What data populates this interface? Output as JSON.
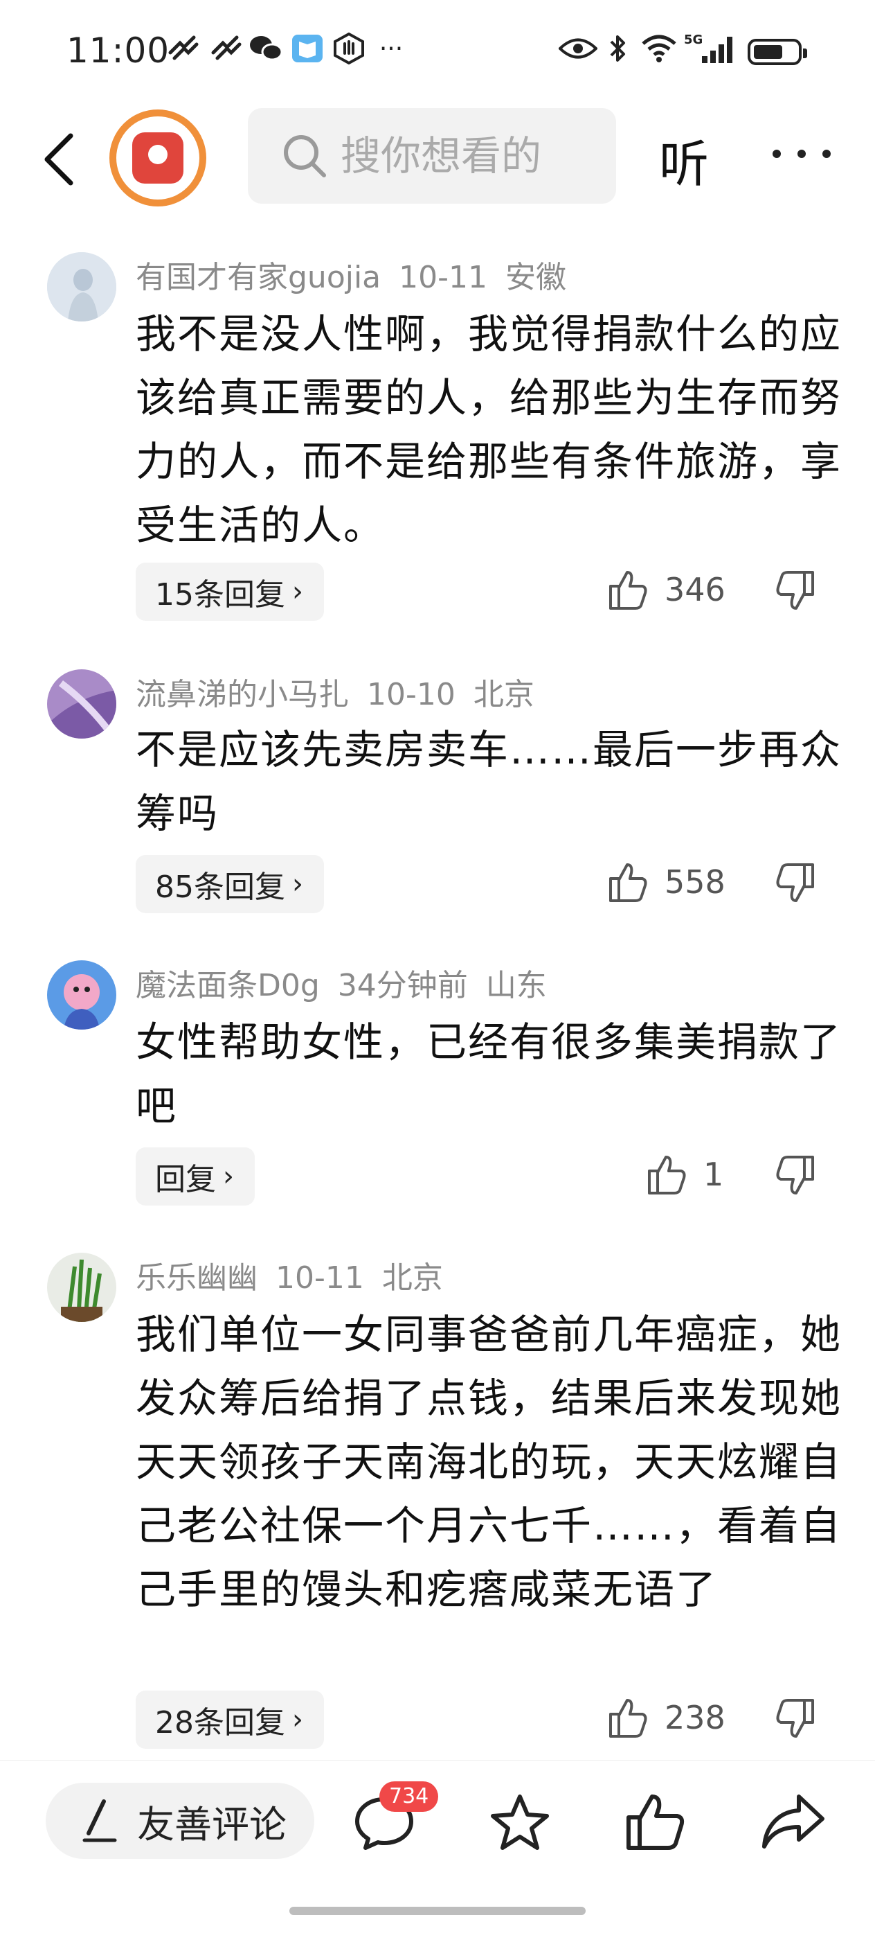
{
  "status_bar": {
    "time": "11:00",
    "network": "5G",
    "colors": {
      "text": "#222222"
    }
  },
  "header": {
    "search_placeholder": "搜你想看的",
    "listen_label": "听",
    "logo_color": "#e0453c",
    "logo_ring_color": "#f0903a"
  },
  "comments": [
    {
      "username": "有国才有家guojia",
      "date": "10-11",
      "location": "安徽",
      "text": "我不是没人性啊，我觉得捐款什么的应该给真正需要的人，给那些为生存而努力的人，而不是给那些有条件旅游，享受生活的人。",
      "reply_label": "15条回复",
      "likes": "346"
    },
    {
      "username": "流鼻涕的小马扎",
      "date": "10-10",
      "location": "北京",
      "text": "不是应该先卖房卖车……最后一步再众筹吗",
      "reply_label": "85条回复",
      "likes": "558"
    },
    {
      "username": "魔法面条D0g",
      "date": "34分钟前",
      "location": "山东",
      "text": "女性帮助女性，已经有很多集美捐款了吧",
      "reply_label": "回复",
      "likes": "1"
    },
    {
      "username": "乐乐幽幽",
      "date": "10-11",
      "location": "北京",
      "text": "我们单位一女同事爸爸前几年癌症，她发众筹后给捐了点钱，结果后来发现她天天领孩子天南海北的玩，天天炫耀自己老公社保一个月六七千……，看着自己手里的馒头和疙瘩咸菜无语了",
      "reply_label": "28条回复",
      "likes": "238"
    }
  ],
  "bottom_bar": {
    "composer_label": "友善评论",
    "comment_count": "734",
    "icons": [
      "pen-icon",
      "comment-icon",
      "star-icon",
      "thumbs-up-icon",
      "share-icon"
    ],
    "badge_color": "#f04848"
  }
}
